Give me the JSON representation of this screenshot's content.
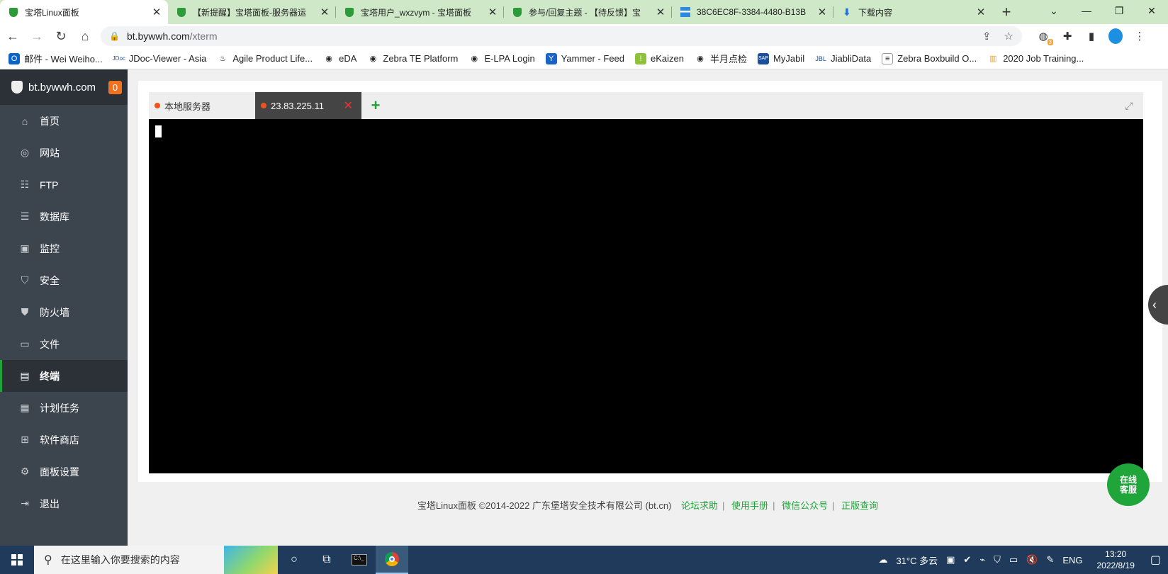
{
  "browser": {
    "tabs": [
      {
        "title": "宝塔Linux面板",
        "icon": "shield-favicon",
        "active": true
      },
      {
        "title": "【新提醒】宝塔面板-服务器运",
        "icon": "shield-favicon"
      },
      {
        "title": "宝塔用户_wxzvym - 宝塔面板",
        "icon": "shield-favicon"
      },
      {
        "title": "参与/回复主题 - 【待反馈】宝",
        "icon": "shield-favicon"
      },
      {
        "title": "38C6EC8F-3384-4480-B13B",
        "icon": "image-favicon"
      },
      {
        "title": "下载内容",
        "icon": "download-favicon"
      }
    ],
    "address": {
      "host": "bt.bywwh.com",
      "path": "/xterm"
    },
    "extension_badge": "3",
    "bookmarks": [
      "邮件 - Wei Weiho...",
      "JDoc-Viewer - Asia",
      "Agile Product Life...",
      "eDA",
      "Zebra TE Platform",
      "E-LPA Login",
      "Yammer - Feed",
      "eKaizen",
      "半月点检",
      "MyJabil",
      "JiabliData",
      "Zebra Boxbuild O...",
      "2020 Job Training..."
    ]
  },
  "panel": {
    "brand": "bt.bywwh.com",
    "notify_count": "0",
    "nav": [
      {
        "label": "首页",
        "icon": "home-icon"
      },
      {
        "label": "网站",
        "icon": "globe-icon"
      },
      {
        "label": "FTP",
        "icon": "ftp-icon"
      },
      {
        "label": "数据库",
        "icon": "database-icon"
      },
      {
        "label": "监控",
        "icon": "monitor-icon"
      },
      {
        "label": "安全",
        "icon": "shield-icon"
      },
      {
        "label": "防火墙",
        "icon": "firewall-icon"
      },
      {
        "label": "文件",
        "icon": "folder-icon"
      },
      {
        "label": "终端",
        "icon": "terminal-icon",
        "active": true
      },
      {
        "label": "计划任务",
        "icon": "calendar-icon"
      },
      {
        "label": "软件商店",
        "icon": "apps-icon"
      },
      {
        "label": "面板设置",
        "icon": "gear-icon"
      },
      {
        "label": "退出",
        "icon": "logout-icon"
      }
    ],
    "terminal_tabs": [
      {
        "label": "本地服务器"
      },
      {
        "label": "23.83.225.11",
        "active": true
      }
    ],
    "footer": {
      "copyright": "宝塔Linux面板 ©2014-2022 广东堡塔安全技术有限公司 (bt.cn)",
      "links": [
        "论坛求助",
        "使用手册",
        "微信公众号",
        "正版查询"
      ]
    },
    "service_button": "在线客服"
  },
  "taskbar": {
    "search_placeholder": "在这里输入你要搜索的内容",
    "weather": "31°C 多云",
    "lang": "ENG",
    "time": "13:20",
    "date": "2022/8/19"
  },
  "colors": {
    "accent": "#20a53a",
    "sidebar": "#3c444d",
    "badge": "#f0711e"
  }
}
